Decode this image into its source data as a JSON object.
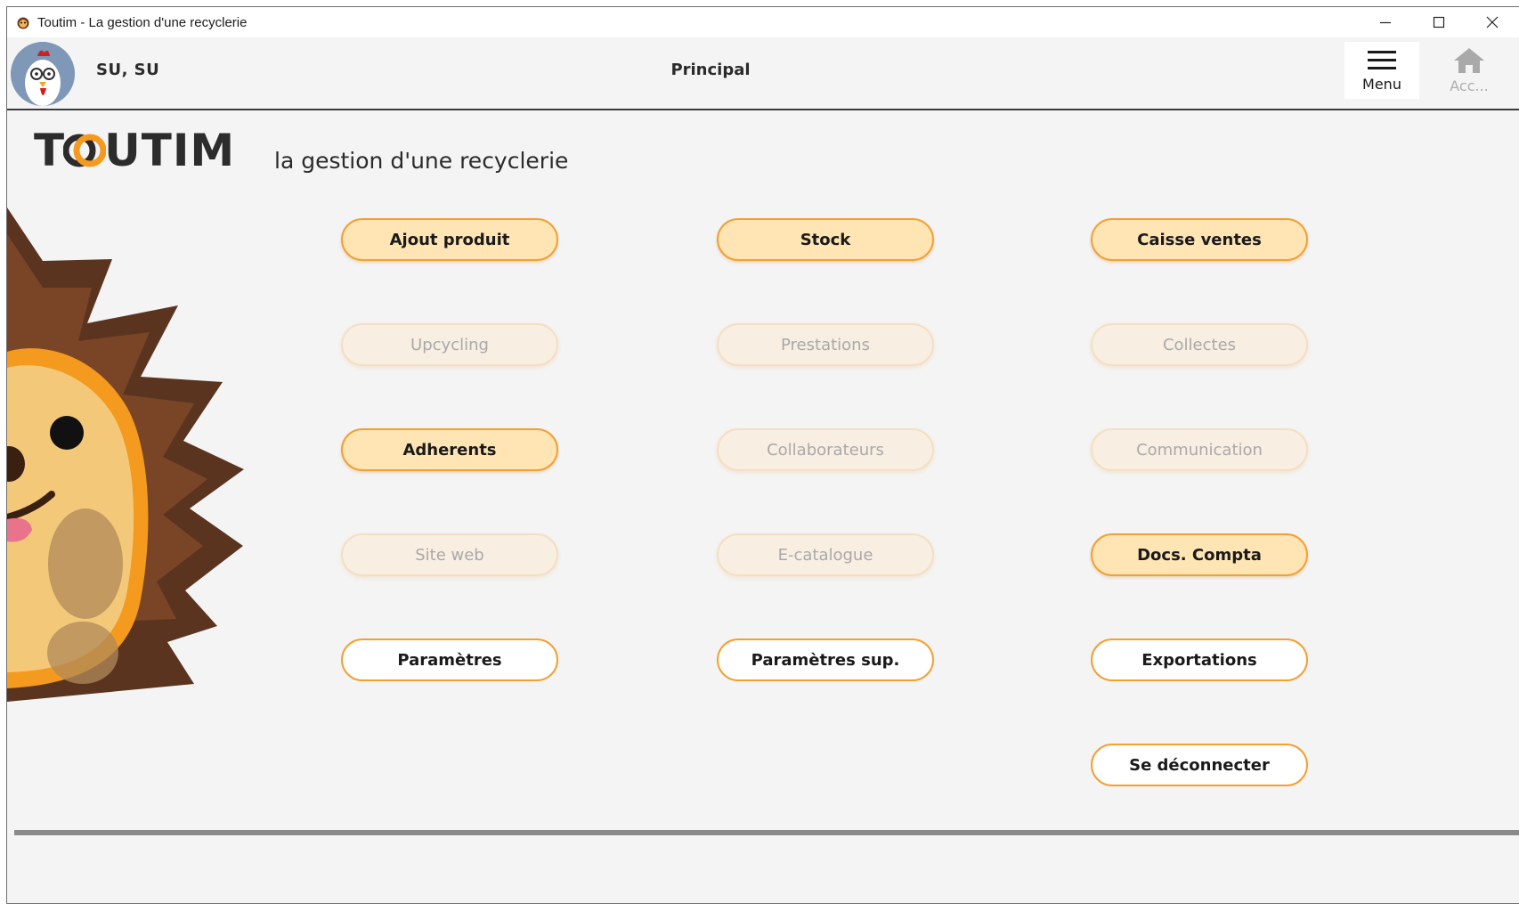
{
  "window": {
    "title": "Toutim - La gestion d'une recyclerie",
    "controls": [
      "minimize",
      "maximize",
      "close"
    ]
  },
  "appbar": {
    "username": "SU, SU",
    "page_title": "Principal",
    "menu_label": "Menu",
    "home_label": "Acc..."
  },
  "branding": {
    "logo_text_start": "T",
    "logo_text_end": "UTIM",
    "tagline": "la gestion d'une recyclerie",
    "accent_color": "#f3a032",
    "button_fill_color": "#ffe4b4"
  },
  "buttons": [
    {
      "label": "Ajout produit",
      "state": "primary"
    },
    {
      "label": "Stock",
      "state": "primary"
    },
    {
      "label": "Caisse ventes",
      "state": "primary"
    },
    {
      "label": "Upcycling",
      "state": "disabled"
    },
    {
      "label": "Prestations",
      "state": "disabled"
    },
    {
      "label": "Collectes",
      "state": "disabled"
    },
    {
      "label": "Adherents",
      "state": "primary"
    },
    {
      "label": "Collaborateurs",
      "state": "disabled"
    },
    {
      "label": "Communication",
      "state": "disabled"
    },
    {
      "label": "Site web",
      "state": "disabled"
    },
    {
      "label": "E-catalogue",
      "state": "disabled"
    },
    {
      "label": "Docs. Compta",
      "state": "primary"
    },
    {
      "label": "Paramètres",
      "state": "white"
    },
    {
      "label": "Paramètres sup.",
      "state": "white"
    },
    {
      "label": "Exportations",
      "state": "white"
    },
    {
      "label": "Se déconnecter",
      "state": "white"
    }
  ]
}
